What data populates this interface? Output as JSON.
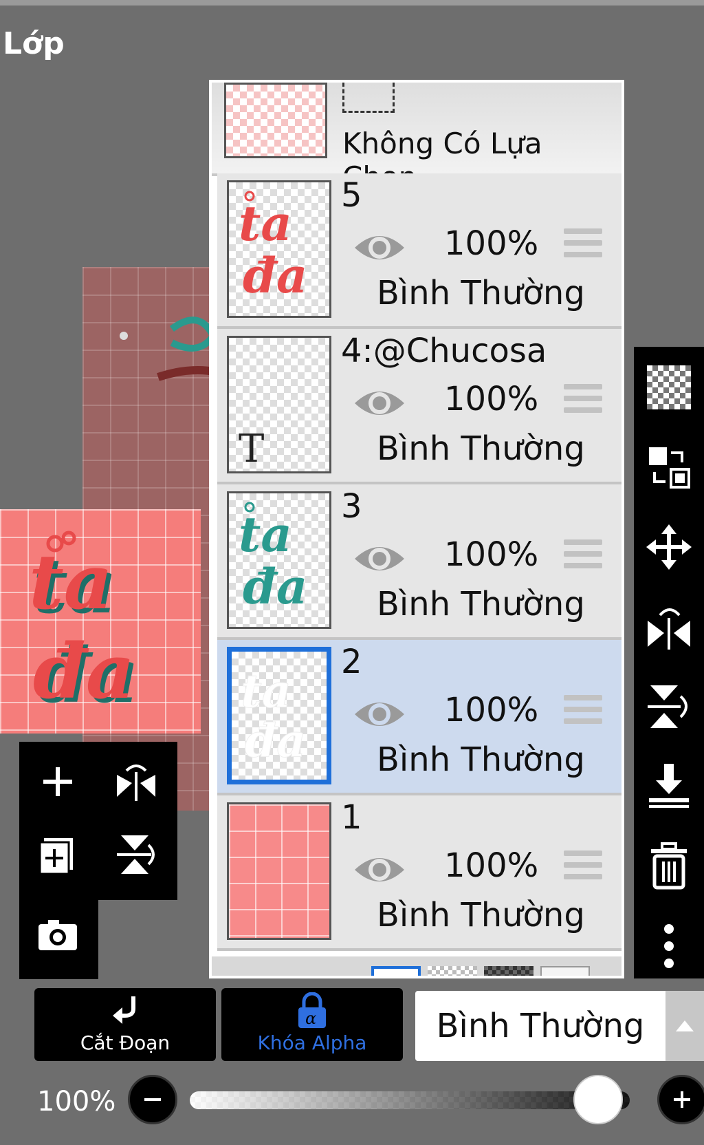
{
  "header": {
    "title": "Lớp"
  },
  "selection_row": {
    "label": "Không Có Lựa Chọn"
  },
  "layers": [
    {
      "name": "5",
      "opacity": "100%",
      "blend": "Bình Thường",
      "visible": true,
      "selected": false,
      "thumb": "red-lettering"
    },
    {
      "name": "4:@Chucosa",
      "opacity": "100%",
      "blend": "Bình Thường",
      "visible": true,
      "selected": false,
      "thumb": "text-layer"
    },
    {
      "name": "3",
      "opacity": "100%",
      "blend": "Bình Thường",
      "visible": true,
      "selected": false,
      "thumb": "teal-lettering"
    },
    {
      "name": "2",
      "opacity": "100%",
      "blend": "Bình Thường",
      "visible": true,
      "selected": true,
      "thumb": "white-lettering"
    },
    {
      "name": "1",
      "opacity": "100%",
      "blend": "Bình Thường",
      "visible": true,
      "selected": false,
      "thumb": "pink-grid"
    }
  ],
  "bottom_bar": {
    "clip_label": "Cắt Đoạn",
    "alpha_lock_label": "Khóa Alpha",
    "blend_mode": "Bình Thường",
    "opacity_value": "100%",
    "opacity_fraction": 1.0
  },
  "left_tools": [
    "add-layer-icon",
    "flip-horizontal-icon",
    "add-copy-layer-icon",
    "flip-vertical-icon",
    "camera-icon"
  ],
  "right_tools": [
    "transparency-icon",
    "swap-layers-icon",
    "move-icon",
    "flip-horizontal-icon",
    "flip-vertical-icon",
    "merge-down-icon",
    "trash-icon",
    "more-vertical-icon"
  ],
  "colors": {
    "selected_bg": "#cddaee",
    "selected_border": "#1e6fd9",
    "alpha_lock": "#2f6fe0",
    "lettering_red": "#e84a4a",
    "lettering_teal": "#2a9a8e",
    "background_pink": "#f57d7b"
  }
}
